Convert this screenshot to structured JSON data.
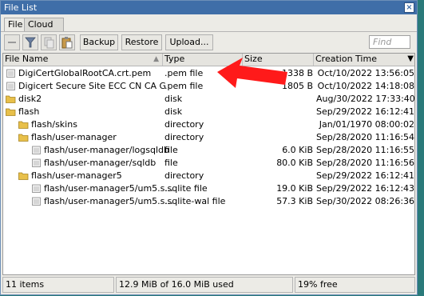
{
  "window": {
    "title": "File List",
    "close_glyph": "×"
  },
  "tabs": [
    {
      "label": "File",
      "active": true
    },
    {
      "label": "Cloud Backup",
      "active": false
    }
  ],
  "toolbar": {
    "backup_label": "Backup",
    "restore_label": "Restore",
    "upload_label": "Upload...",
    "find_placeholder": "Find"
  },
  "columns": {
    "name": "File Name",
    "type": "Type",
    "size": "Size",
    "ctime": "Creation Time"
  },
  "rows": [
    {
      "name": "DigiCertGlobalRootCA.crt.pem",
      "type": ".pem file",
      "size": "1338 B",
      "ctime": "Oct/10/2022 13:56:05",
      "icon": "file-icon",
      "indent": 0
    },
    {
      "name": "Digicert Secure Site ECC CN CA G3...",
      "type": ".pem file",
      "size": "1805 B",
      "ctime": "Oct/10/2022 14:18:08",
      "icon": "file-icon",
      "indent": 0
    },
    {
      "name": "disk2",
      "type": "disk",
      "size": "",
      "ctime": "Aug/30/2022 17:33:40",
      "icon": "folder-icon",
      "indent": 0
    },
    {
      "name": "flash",
      "type": "disk",
      "size": "",
      "ctime": "Sep/29/2022 16:12:41",
      "icon": "folder-icon",
      "indent": 0
    },
    {
      "name": "flash/skins",
      "type": "directory",
      "size": "",
      "ctime": "Jan/01/1970 08:00:02",
      "icon": "folder-icon",
      "indent": 1
    },
    {
      "name": "flash/user-manager",
      "type": "directory",
      "size": "",
      "ctime": "Sep/28/2020 11:16:54",
      "icon": "folder-icon",
      "indent": 1
    },
    {
      "name": "flash/user-manager/logsqldb",
      "type": "file",
      "size": "6.0 KiB",
      "ctime": "Sep/28/2020 11:16:55",
      "icon": "file-icon",
      "indent": 2
    },
    {
      "name": "flash/user-manager/sqldb",
      "type": "file",
      "size": "80.0 KiB",
      "ctime": "Sep/28/2020 11:16:56",
      "icon": "file-icon",
      "indent": 2
    },
    {
      "name": "flash/user-manager5",
      "type": "directory",
      "size": "",
      "ctime": "Sep/29/2022 16:12:41",
      "icon": "folder-icon",
      "indent": 1
    },
    {
      "name": "flash/user-manager5/um5.s...",
      "type": ".sqlite file",
      "size": "19.0 KiB",
      "ctime": "Sep/29/2022 16:12:43",
      "icon": "file-icon",
      "indent": 2
    },
    {
      "name": "flash/user-manager5/um5.s...",
      "type": ".sqlite-wal file",
      "size": "57.3 KiB",
      "ctime": "Sep/30/2022 08:26:36",
      "icon": "file-icon",
      "indent": 2
    }
  ],
  "status": {
    "items": "11 items",
    "used": "12.9 MiB of 16.0 MiB used",
    "free": "19% free"
  },
  "colors": {
    "titlebar": "#3f6ea8",
    "annotation_arrow": "#ff1a1a",
    "folder": "#e8c04a"
  }
}
